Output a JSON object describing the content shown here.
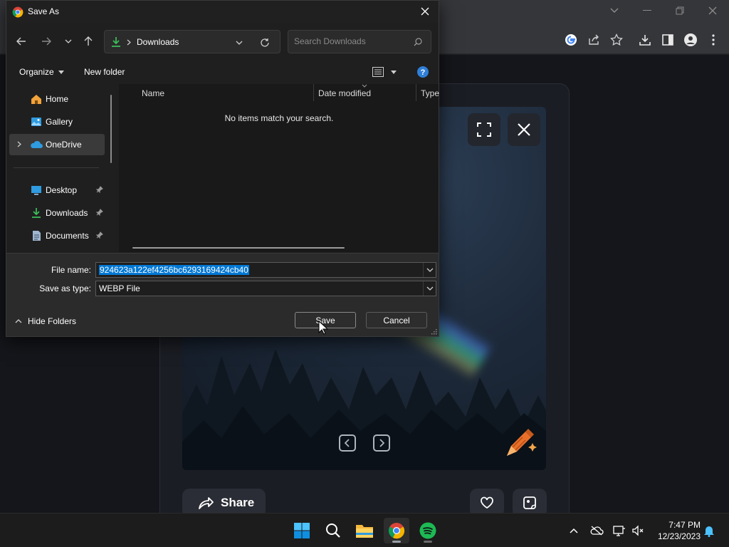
{
  "dialog": {
    "title": "Save As",
    "address": {
      "location": "Downloads"
    },
    "search": {
      "placeholder": "Search Downloads"
    },
    "commands": {
      "organize": "Organize",
      "new_folder": "New folder"
    },
    "nav_items": [
      {
        "label": "Home",
        "icon": "home-icon"
      },
      {
        "label": "Gallery",
        "icon": "gallery-icon"
      },
      {
        "label": "OneDrive",
        "icon": "cloud-icon",
        "selected": true
      },
      {
        "label": "Desktop",
        "icon": "desktop-icon",
        "pinned": true
      },
      {
        "label": "Downloads",
        "icon": "download-icon",
        "pinned": true
      },
      {
        "label": "Documents",
        "icon": "document-icon",
        "pinned": true
      }
    ],
    "columns": {
      "name": "Name",
      "date_modified": "Date modified",
      "type": "Type"
    },
    "empty_message": "No items match your search.",
    "file_name_label": "File name:",
    "file_name_value": "924623a122ef4256bc6293169424cb40",
    "save_type_label": "Save as type:",
    "save_type_value": "WEBP File",
    "hide_folders": "Hide Folders",
    "save_label": "Save",
    "cancel_label": "Cancel"
  },
  "viewer": {
    "share_label": "Share"
  },
  "taskbar": {
    "apps": [
      "start-icon",
      "search-icon",
      "file-explorer-icon",
      "chrome-icon",
      "spotify-icon"
    ],
    "time": "7:47 PM",
    "date": "12/23/2023"
  },
  "colors": {
    "accent": "#0078d4",
    "spotify": "#1db954",
    "downloads": "#3dbf5a"
  }
}
